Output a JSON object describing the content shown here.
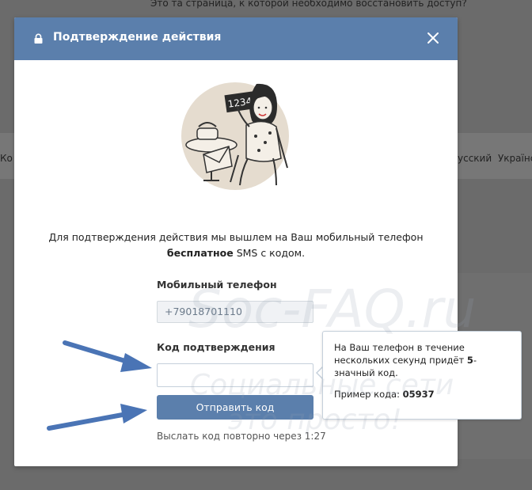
{
  "background": {
    "top_text": "Это та страница, к которой необходимо восстановить доступ?",
    "left_text": "Ко",
    "languages": [
      "усский",
      "Українс"
    ]
  },
  "modal": {
    "title": "Подтверждение действия",
    "description_line1": "Для подтверждения действия мы вышлем на Ваш мобильный телефон",
    "description_bold": "бесплатное",
    "description_rest": " SMS с кодом.",
    "phone_label": "Мобильный телефон",
    "phone_value": "+79018701110",
    "code_label": "Код подтверждения",
    "code_value": "",
    "send_button": "Отправить код",
    "resend_text": "Выслать код повторно через 1:27",
    "illustration_code": "1234"
  },
  "tooltip": {
    "text_before": "На Ваш телефон в течение нескольких секунд придёт ",
    "text_bold": "5",
    "text_after": "-значный код.",
    "example_label": "Пример кода: ",
    "example_code": "05937"
  },
  "watermark": {
    "line1": "Soc-FAQ.ru",
    "line2": "Социальные сети",
    "line3": "это просто!"
  },
  "colors": {
    "header": "#5b7fac",
    "button": "#5b7fac",
    "arrow": "#4a74b5"
  }
}
